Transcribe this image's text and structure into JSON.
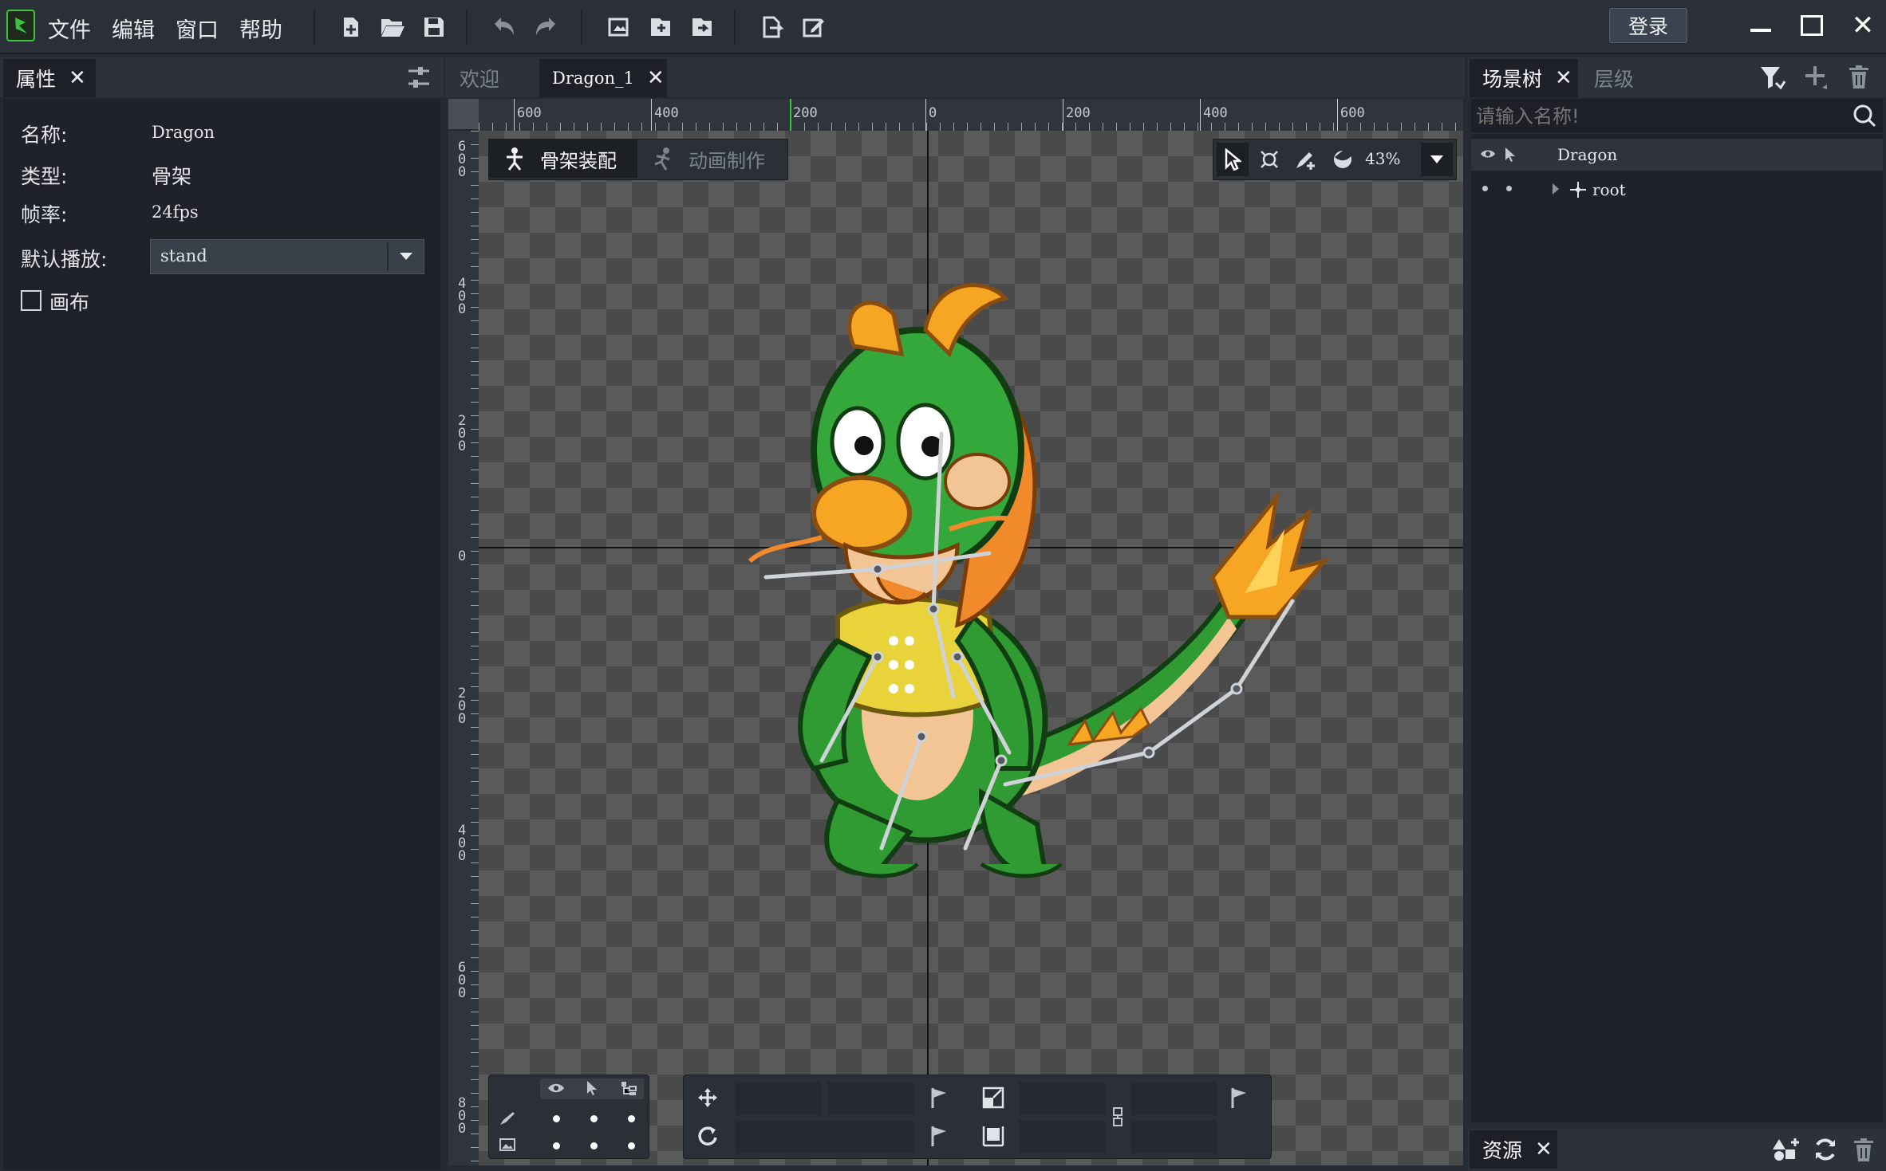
{
  "app": {
    "menu": [
      "文件",
      "编辑",
      "窗口",
      "帮助"
    ],
    "login_label": "登录"
  },
  "properties_panel": {
    "tab_label": "属性",
    "fields": {
      "name_label": "名称:",
      "name_value": "Dragon",
      "type_label": "类型:",
      "type_value": "骨架",
      "fps_label": "帧率:",
      "fps_value": "24fps",
      "default_play_label": "默认播放:",
      "default_play_value": "stand",
      "canvas_label": "画布"
    }
  },
  "editor": {
    "tabs": [
      "欢迎",
      "Dragon_1"
    ],
    "active_tab": "Dragon_1",
    "mode_rig": "骨架装配",
    "mode_anim": "动画制作",
    "zoom": "43%",
    "ruler_top": [
      "600",
      "400",
      "200",
      "0",
      "200",
      "400",
      "600"
    ],
    "ruler_left": [
      "600",
      "400",
      "200",
      "0",
      "200",
      "400",
      "600",
      "800"
    ]
  },
  "scene_tree": {
    "tab_label": "场景树",
    "tab2_label": "层级",
    "search_placeholder": "请输入名称!",
    "root_node": "Dragon",
    "child_node": "root"
  },
  "assets_panel": {
    "tab_label": "资源"
  },
  "icons": {
    "logo": "app-logo-icon",
    "new": "new-file-icon",
    "open": "open-folder-icon",
    "save": "save-icon",
    "undo": "undo-icon",
    "redo": "redo-icon"
  },
  "colors": {
    "accent_green": "#3ec33e",
    "panel_bg": "#252a31",
    "checker_dark": "#4a4a4a",
    "checker_light": "#5a5a5a"
  }
}
